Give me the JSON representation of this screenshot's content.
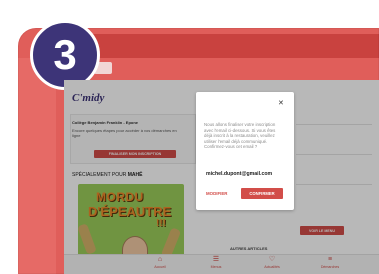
{
  "step": {
    "number": "3"
  },
  "topbar": {
    "tab_label": ""
  },
  "header": {
    "logo": "C'midy"
  },
  "card": {
    "school": "Collège Benjamin Franklin - Epone",
    "message": "Encore quelques étapes pour accéder à vos démarches en ligne",
    "finish_button": "FINALISER MON INSCRIPTION"
  },
  "special": {
    "prefix": "SPÉCIALEMENT POUR",
    "name": "MAHÉ"
  },
  "promo": {
    "line1": "MORDU",
    "line2": "D'ÉPEAUTRE",
    "bang": "!!!"
  },
  "right": {
    "voir_menu": "VOIR LE MENU",
    "autres": "AUTRES ARTICLES"
  },
  "modal": {
    "message": "Nous allons finaliser votre inscription avec l'email ci-dessous. Si vous êtes déjà inscrit à la restauration, veuillez utiliser l'email déjà communiqué. Confirmez-vous cet email ?",
    "email": "michel.dupont@gmail.com",
    "modify_label": "MODIFIER",
    "confirm_label": "CONFIRMER"
  },
  "nav": {
    "items": [
      {
        "label": "Accueil",
        "icon": "home-icon"
      },
      {
        "label": "Menus",
        "icon": "menu-icon"
      },
      {
        "label": "Actualités",
        "icon": "heart-icon"
      },
      {
        "label": "Démarches",
        "icon": "list-icon"
      }
    ]
  },
  "colors": {
    "accent": "#d24d49",
    "badge": "#3d3478",
    "frame": "#e05e5a"
  }
}
